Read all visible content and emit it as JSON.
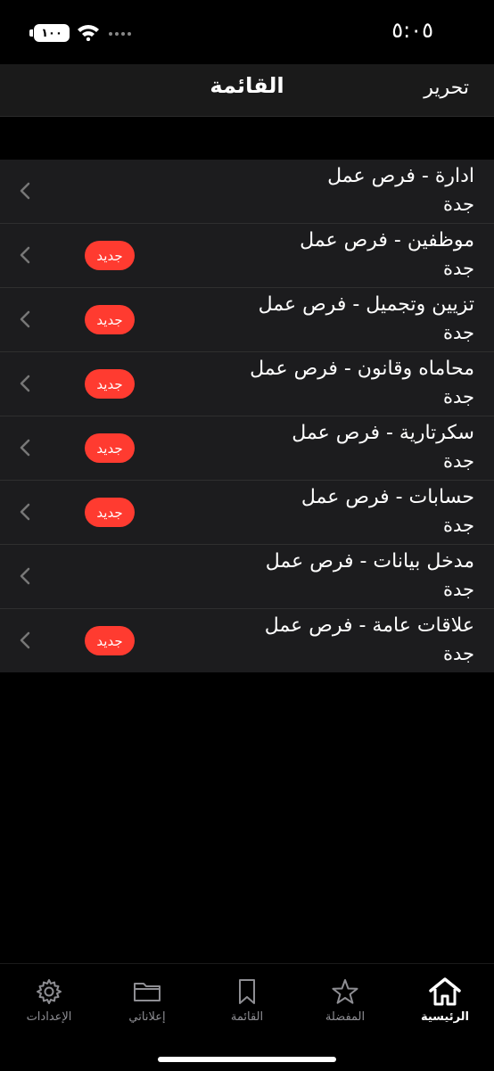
{
  "status": {
    "time": "٥:٠٥",
    "battery": "١٠٠"
  },
  "nav": {
    "title": "القائمة",
    "edit_label": "تحرير"
  },
  "list": [
    {
      "title": "ادارة - فرص عمل",
      "subtitle": "جدة",
      "badge": ""
    },
    {
      "title": "موظفين - فرص عمل",
      "subtitle": "جدة",
      "badge": "جديد"
    },
    {
      "title": "تزيين وتجميل - فرص عمل",
      "subtitle": "جدة",
      "badge": "جديد"
    },
    {
      "title": "محاماه وقانون - فرص عمل",
      "subtitle": "جدة",
      "badge": "جديد"
    },
    {
      "title": "سكرتارية - فرص عمل",
      "subtitle": "جدة",
      "badge": "جديد"
    },
    {
      "title": "حسابات - فرص عمل",
      "subtitle": "جدة",
      "badge": "جديد"
    },
    {
      "title": "مدخل بيانات - فرص عمل",
      "subtitle": "جدة",
      "badge": ""
    },
    {
      "title": "علاقات عامة - فرص عمل",
      "subtitle": "جدة",
      "badge": "جديد"
    }
  ],
  "tabs": [
    {
      "label": "الرئيسية",
      "icon": "home-icon",
      "active": true
    },
    {
      "label": "المفضلة",
      "icon": "star-icon",
      "active": false
    },
    {
      "label": "القائمة",
      "icon": "bookmark-icon",
      "active": false
    },
    {
      "label": "إعلاناتي",
      "icon": "folder-icon",
      "active": false
    },
    {
      "label": "الإعدادات",
      "icon": "gear-icon",
      "active": false
    }
  ],
  "colors": {
    "badge": "#ff3b30",
    "background": "#000000",
    "row": "#1c1c1e"
  }
}
